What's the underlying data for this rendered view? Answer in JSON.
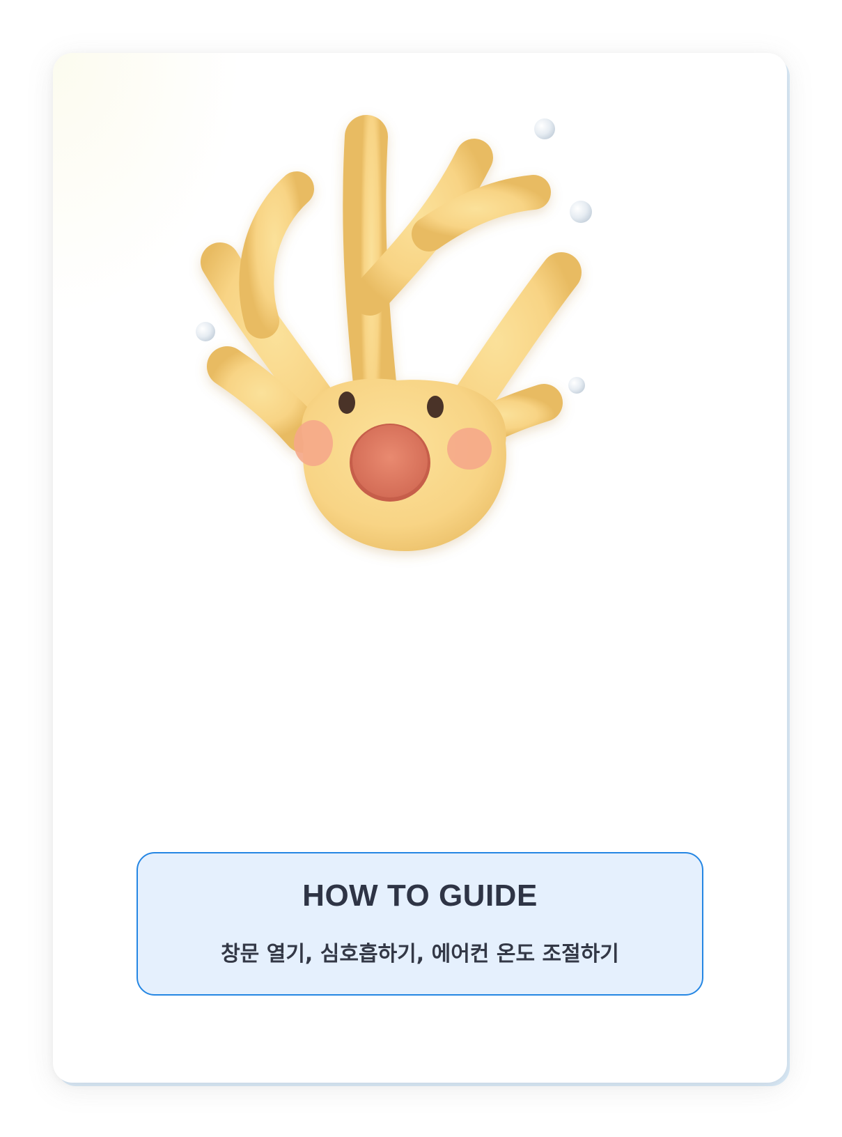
{
  "illustration": {
    "icon": "surprised-coral-character-icon",
    "colors": {
      "body": "#f8d485",
      "cheeks": "#f5a98a",
      "mouth": "#e27a62",
      "eyes": "#4a3328",
      "bubbles": "#dde5ee"
    }
  },
  "guide": {
    "title": "HOW TO GUIDE",
    "description": "창문 열기, 심호흡하기, 에어컨 온도 조절하기",
    "colors": {
      "border": "#2486e3",
      "background": "#e5f0fd",
      "text": "#2e3445"
    }
  }
}
